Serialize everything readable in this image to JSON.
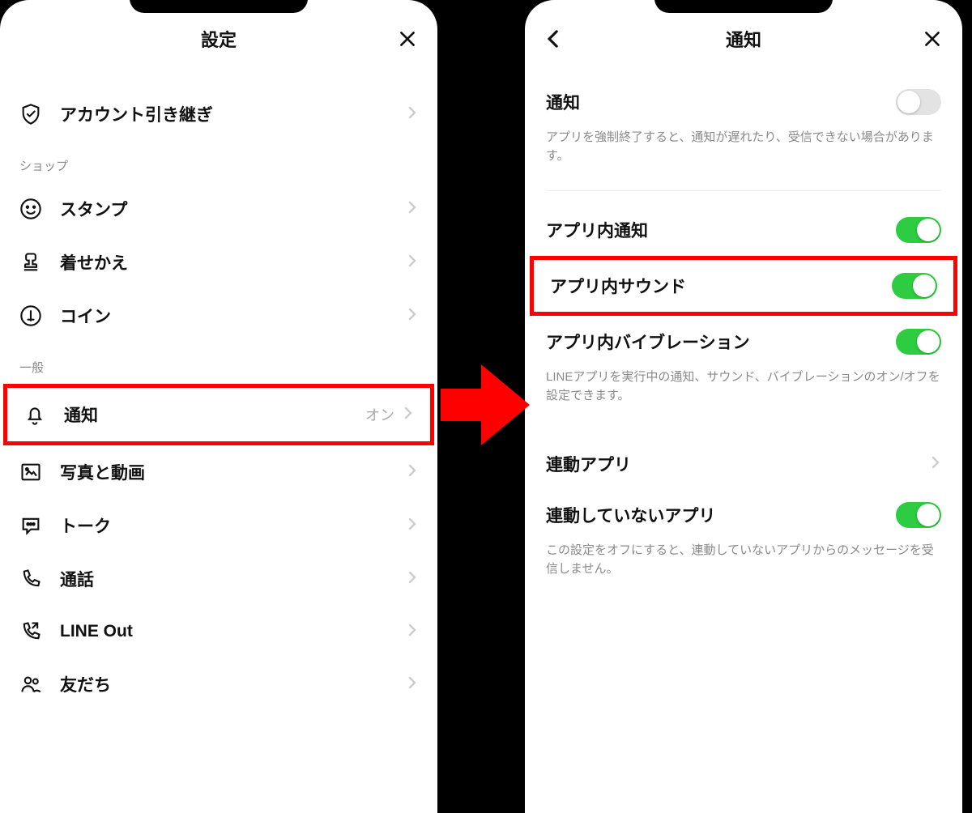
{
  "left": {
    "title": "設定",
    "rows": {
      "account_transfer": "アカウント引き継ぎ"
    },
    "section_shop": "ショップ",
    "shop": {
      "stamp": "スタンプ",
      "theme": "着せかえ",
      "coin": "コイン"
    },
    "section_general": "一般",
    "general": {
      "notification": "通知",
      "notification_status": "オン",
      "photo_video": "写真と動画",
      "talk": "トーク",
      "call": "通話",
      "line_out": "LINE Out",
      "friends": "友だち"
    }
  },
  "right": {
    "title": "通知",
    "notif": {
      "label": "通知",
      "on": false,
      "desc": "アプリを強制終了すると、通知が遅れたり、受信できない場合があります。"
    },
    "inapp_notif": {
      "label": "アプリ内通知",
      "on": true
    },
    "inapp_sound": {
      "label": "アプリ内サウンド",
      "on": true
    },
    "inapp_vibe": {
      "label": "アプリ内バイブレーション",
      "on": true
    },
    "inapp_desc": "LINEアプリを実行中の通知、サウンド、バイブレーションのオン/オフを設定できます。",
    "linked_apps": {
      "label": "連動アプリ"
    },
    "unlinked_apps": {
      "label": "連動していないアプリ",
      "on": true,
      "desc": "この設定をオフにすると、連動していないアプリからのメッセージを受信しません。"
    }
  }
}
